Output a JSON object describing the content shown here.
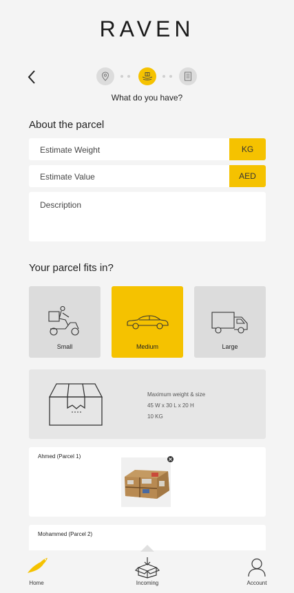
{
  "app": {
    "brand": "RAVEN"
  },
  "stepper": {
    "caption": "What do you have?",
    "steps": [
      {
        "icon": "location-pin-icon",
        "state": "done"
      },
      {
        "icon": "parcel-hands-icon",
        "state": "active"
      },
      {
        "icon": "document-icon",
        "state": "upcoming"
      }
    ]
  },
  "about": {
    "title": "About the parcel",
    "weight": {
      "placeholder": "Estimate Weight",
      "value": "",
      "unit": "KG"
    },
    "value": {
      "placeholder": "Estimate Value",
      "value": "",
      "unit": "AED"
    },
    "description": {
      "placeholder": "Description",
      "value": ""
    }
  },
  "fits": {
    "title": "Your parcel fits in?",
    "options": [
      {
        "label": "Small",
        "icon": "scooter-delivery-icon",
        "selected": false
      },
      {
        "label": "Medium",
        "icon": "car-icon",
        "selected": true
      },
      {
        "label": "Large",
        "icon": "truck-icon",
        "selected": false
      }
    ]
  },
  "size_info": {
    "icon": "box-icon",
    "line1": "Maximum weight & size",
    "line2": "45 W x 30 L x 20 H",
    "line3": "10 KG"
  },
  "parcels": [
    {
      "name": "Ahmed (Parcel 1)",
      "has_photo": true
    },
    {
      "name": "Mohammed (Parcel 2)",
      "has_photo": false
    }
  ],
  "tabbar": {
    "home": "Home",
    "incoming": "Incoming",
    "account": "Account"
  },
  "colors": {
    "accent": "#f5c200",
    "background": "#f4f4f4",
    "card_gray": "#dcdcdc"
  }
}
